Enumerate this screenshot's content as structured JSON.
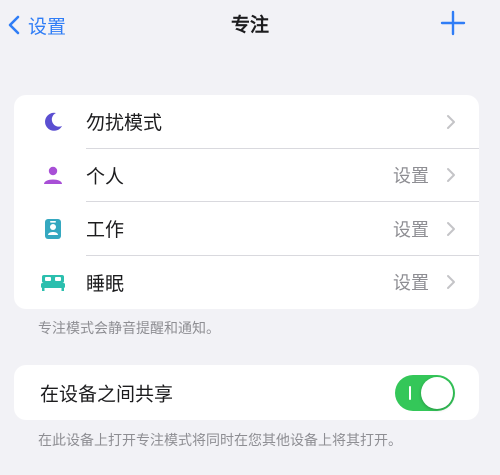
{
  "nav": {
    "back_label": "设置",
    "title": "专注",
    "add_icon": "plus-icon"
  },
  "modes": [
    {
      "label": "勿扰模式",
      "value": "",
      "icon": "moon-icon",
      "color": "#5b4fd1"
    },
    {
      "label": "个人",
      "value": "设置",
      "icon": "person-icon",
      "color": "#a84fd6"
    },
    {
      "label": "工作",
      "value": "设置",
      "icon": "id-badge-icon",
      "color": "#35a8c0"
    },
    {
      "label": "睡眠",
      "value": "设置",
      "icon": "bed-icon",
      "color": "#2bbfae"
    }
  ],
  "modes_footnote": "专注模式会静音提醒和通知。",
  "share": {
    "label": "在设备之间共享",
    "toggle_on": true,
    "footnote": "在此设备上打开专注模式将同时在您其他设备上将其打开。"
  },
  "colors": {
    "accent": "#2f7df6",
    "toggle_on": "#34c759",
    "background": "#f2f2f6"
  }
}
